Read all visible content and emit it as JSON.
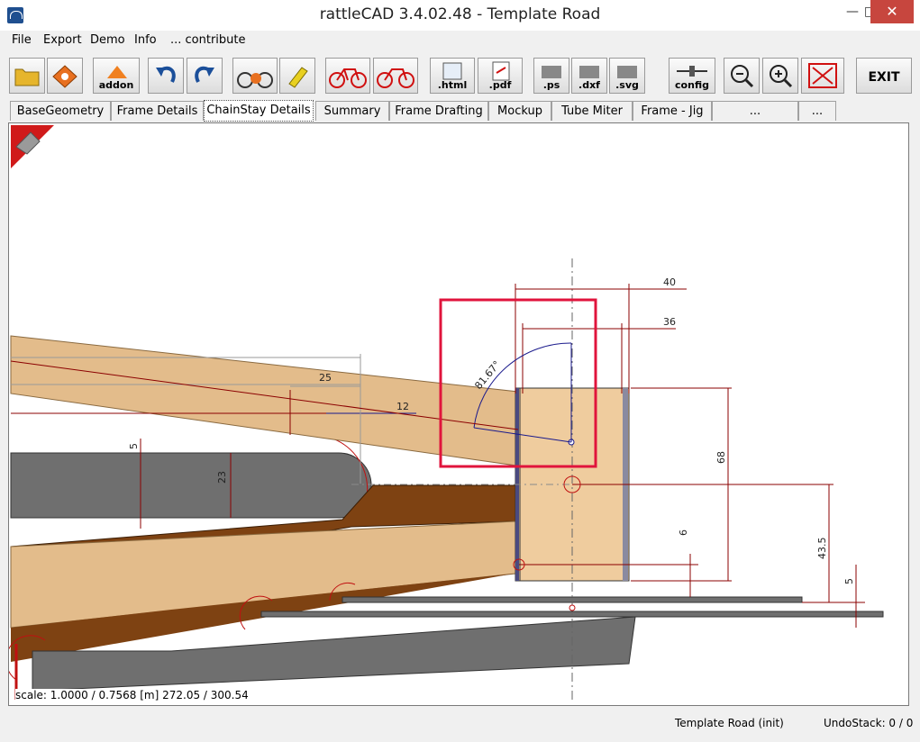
{
  "window": {
    "title": "rattleCAD  3.4.02.48 - Template Road",
    "minimize_glyph": "—",
    "maximize_glyph": "□",
    "close_glyph": "✕"
  },
  "menu": {
    "items": [
      {
        "label": "File"
      },
      {
        "label": "Export"
      },
      {
        "label": "Demo"
      },
      {
        "label": "Info"
      },
      {
        "label": "... contribute"
      }
    ]
  },
  "toolbar": {
    "buttons": [
      {
        "name": "open-folder-icon",
        "label": ""
      },
      {
        "name": "save-icon",
        "label": ""
      },
      {
        "name": "addon-icon",
        "label": "addon"
      },
      {
        "name": "undo-icon",
        "label": ""
      },
      {
        "name": "redo-icon",
        "label": ""
      },
      {
        "name": "bike-render-icon",
        "label": ""
      },
      {
        "name": "paint-icon",
        "label": ""
      },
      {
        "name": "bike-red-icon",
        "label": ""
      },
      {
        "name": "bike-red-compare-icon",
        "label": ""
      },
      {
        "name": "html-export-icon",
        "label": ".html"
      },
      {
        "name": "pdf-export-icon",
        "label": ".pdf"
      },
      {
        "name": "ps-export-icon",
        "label": ".ps"
      },
      {
        "name": "dxf-export-icon",
        "label": ".dxf"
      },
      {
        "name": "svg-export-icon",
        "label": ".svg"
      },
      {
        "name": "config-icon",
        "label": "config"
      },
      {
        "name": "zoom-out-icon",
        "label": ""
      },
      {
        "name": "zoom-in-icon",
        "label": ""
      },
      {
        "name": "fit-screen-icon",
        "label": ""
      },
      {
        "name": "exit-icon",
        "label": "EXIT"
      }
    ]
  },
  "tabs": [
    {
      "label": "BaseGeometry"
    },
    {
      "label": "Frame Details"
    },
    {
      "label": "ChainStay Details",
      "active": true
    },
    {
      "label": "Summary"
    },
    {
      "label": "Frame Drafting"
    },
    {
      "label": "Mockup"
    },
    {
      "label": "Tube Miter"
    },
    {
      "label": "Frame - Jig"
    },
    {
      "label": "... Components"
    },
    {
      "label": "... info"
    }
  ],
  "drawing": {
    "dimensions": {
      "d40": "40",
      "d36": "36",
      "angle": "81.67°",
      "d25": "25",
      "d12": "12",
      "d5a": "5",
      "d23": "23",
      "d68": "68",
      "d6": "6",
      "d435": "43.5",
      "d5b": "5"
    },
    "scale_text": "scale: 1.0000 / 0.7568  [m]  272.05 / 300.54",
    "colors": {
      "tube_light": "#e3bc8b",
      "tube_brown": "#7e4212",
      "tube_gray": "#6f6f6f",
      "dropout_fill": "#efcc9e",
      "dim_red": "#8b0000",
      "highlight_red": "#e0143c",
      "dim_blue": "#1a1a8c"
    }
  },
  "status": {
    "left": "Template Road (init)",
    "undo": "UndoStack:  0 / 0"
  }
}
